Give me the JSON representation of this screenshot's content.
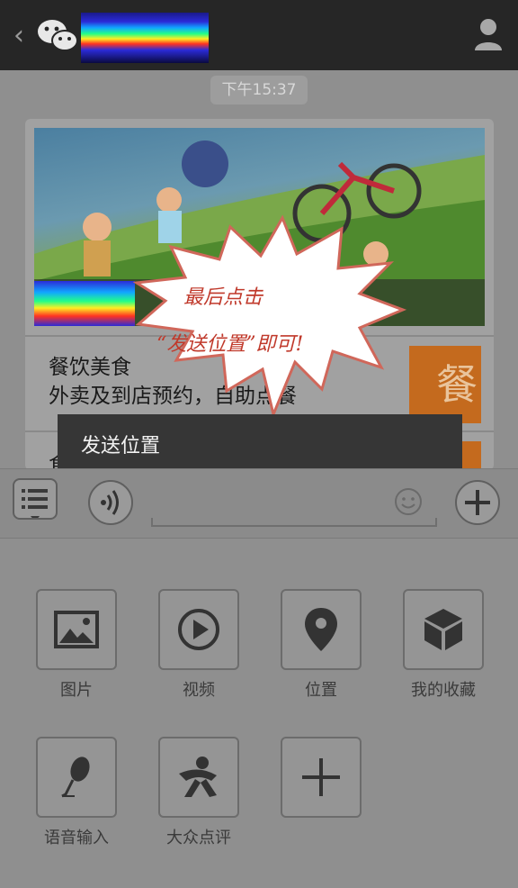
{
  "header": {
    "back_icon": "chevron-left-icon",
    "logo_icon": "wechat-icon",
    "profile_icon": "person-icon"
  },
  "chat": {
    "timestamp": "下午15:37"
  },
  "card": {
    "item1_title": "餐饮美食",
    "item1_subtitle": "外卖及到店预约，自助点餐",
    "item1_thumb_char": "餐",
    "item2_partial": "食"
  },
  "annotation": {
    "line1": "最后点击",
    "line2": "“发送位置”即可!"
  },
  "popup": {
    "label": "发送位置"
  },
  "input_bar": {
    "menu_icon": "list-menu-icon",
    "voice_icon": "voice-icon",
    "emoji_icon": "emoji-icon",
    "plus_icon": "plus-icon"
  },
  "attachments": [
    {
      "label": "图片",
      "icon": "image-icon"
    },
    {
      "label": "视频",
      "icon": "video-play-icon"
    },
    {
      "label": "位置",
      "icon": "location-pin-icon"
    },
    {
      "label": "我的收藏",
      "icon": "favorites-cube-icon"
    },
    {
      "label": "语音输入",
      "icon": "microphone-icon"
    },
    {
      "label": "大众点评",
      "icon": "dianping-icon"
    },
    {
      "label": "",
      "icon": "add-icon"
    }
  ],
  "colors": {
    "topbar": "#262626",
    "overlay": "#8f8f8f",
    "popup": "#363636",
    "accent_orange": "#c46a1e",
    "annotation_red": "#c0392b"
  }
}
